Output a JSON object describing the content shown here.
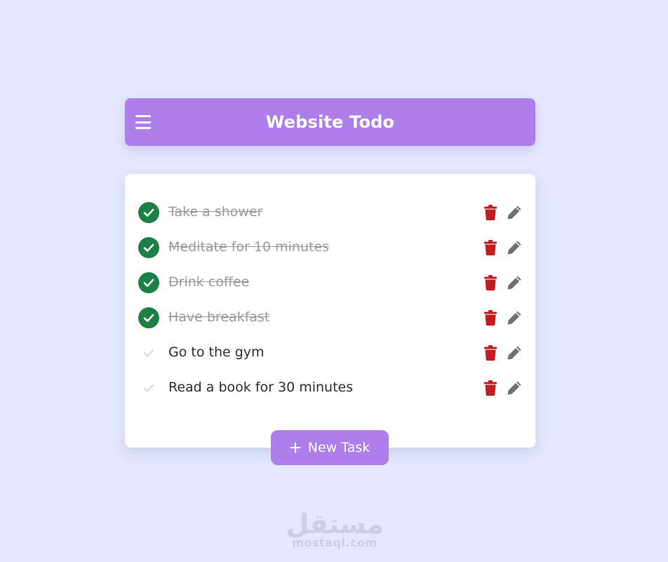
{
  "header": {
    "title": "Website Todo",
    "menu_icon": "hamburger-menu-icon",
    "background_color": "#ae7fea"
  },
  "tasks": [
    {
      "text": "Take a shower",
      "completed": true
    },
    {
      "text": "Meditate for 10 minutes",
      "completed": true
    },
    {
      "text": "Drink coffee",
      "completed": true
    },
    {
      "text": "Have breakfast",
      "completed": true
    },
    {
      "text": "Go to the gym",
      "completed": false
    },
    {
      "text": "Read a book for 30 minutes",
      "completed": false
    }
  ],
  "task_actions": {
    "delete_icon": "trash-icon",
    "edit_icon": "pencil-icon"
  },
  "new_task_button": {
    "label": "New Task",
    "icon": "plus-icon"
  },
  "watermark": {
    "arabic": "مستقل",
    "latin": "mostaql.com"
  },
  "colors": {
    "background": "#e3e8fe",
    "accent": "#ae7fea",
    "done_check": "#1a8045",
    "pending_check": "#d9d9dc",
    "delete": "#c01e1e",
    "edit": "#6f6f78",
    "completed_text": "#9a9a9a"
  }
}
